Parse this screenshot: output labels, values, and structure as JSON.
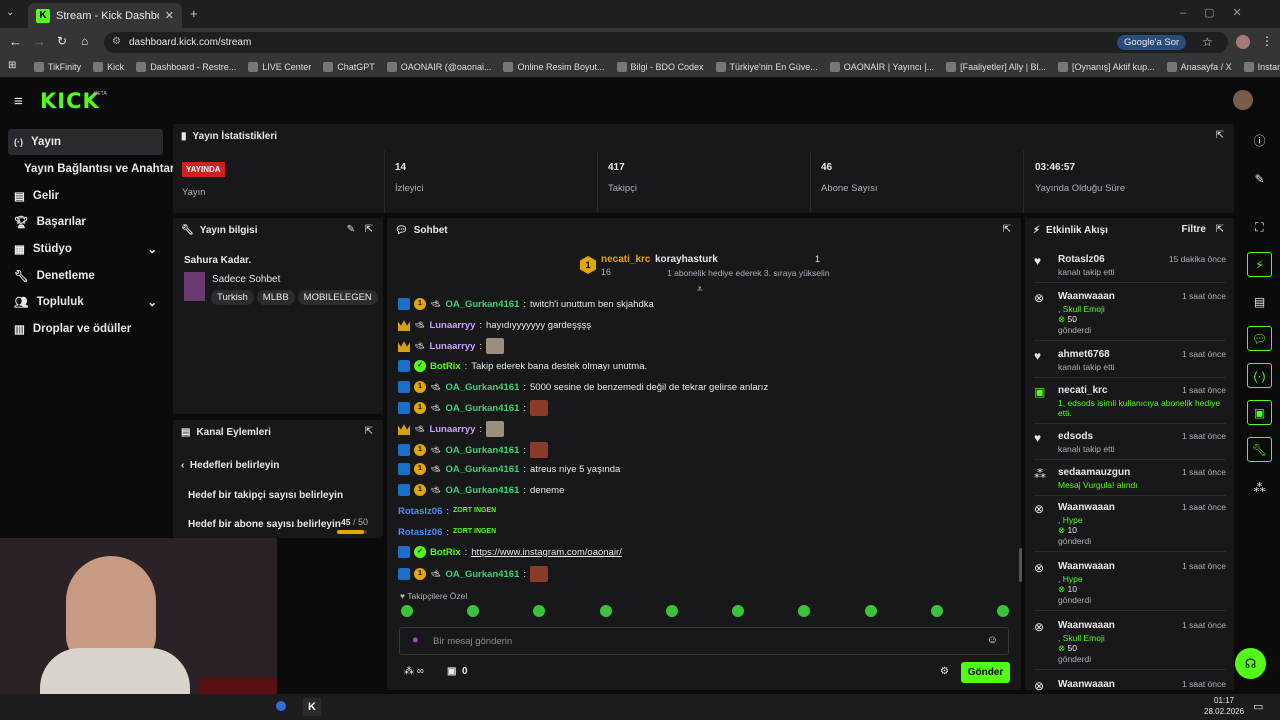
{
  "browser": {
    "tab_title": "Stream - Kick Dashboard",
    "url": "dashboard.kick.com/stream",
    "google_btn": "Google'a Sor",
    "bookmarks": [
      "TikFinity",
      "Kick",
      "Dashboard - Restre...",
      "LIVE Center",
      "ChatGPT",
      "OAONAIR (@oaonai...",
      "Online Resim Boyut...",
      "Bilgi - BDO Codex",
      "Türkiye'nin En Güve...",
      "OAONAIR | Yayıncı |...",
      "[Faaliyetler] Ally | Bl...",
      "[Oynanış] Aktif kup...",
      "Anasayfa / X",
      "Instant Background..."
    ]
  },
  "app": {
    "logo": "KICK",
    "beta": "BETA"
  },
  "nav": {
    "items": [
      "Yayın",
      "Yayın Bağlantısı ve Anahtarı",
      "Gelir",
      "Başarılar",
      "Stüdyo",
      "Denetleme",
      "Topluluk",
      "Droplar ve ödüller"
    ]
  },
  "stats": {
    "title": "Yayın İstatistikleri",
    "live_badge": "YAYINDA",
    "live_label": "Yayın",
    "items": [
      {
        "value": "14",
        "label": "İzleyici"
      },
      {
        "value": "417",
        "label": "Takipçi"
      },
      {
        "value": "46",
        "label": "Abone Sayısı"
      },
      {
        "value": "03:46:57",
        "label": "Yayında Olduğu Süre"
      }
    ]
  },
  "stream_info": {
    "title": "Yayın bilgisi",
    "stream_title": "Sahura Kadar.",
    "category": "Sadece Sohbet",
    "tags": [
      "Turkish",
      "MLBB",
      "MOBILELEGEN"
    ]
  },
  "channel_actions": {
    "title": "Kanal Eylemleri",
    "back": "Hedefleri belirleyin",
    "goal1": "Hedef bir takipçi sayısı belirleyin",
    "goal2": "Hedef bir abone sayısı belirleyin",
    "goal2_current": "45",
    "goal2_sep": " / ",
    "goal2_target": "50",
    "goal2_progress": 0.9
  },
  "chat": {
    "title": "Sohbet",
    "top_user": "necati_krc",
    "top_rank": "1",
    "top_count": "16",
    "gift_user": "korayhasturk",
    "gift_count": "1",
    "gift_text": "1 abonelik hediye ederek 3. sıraya yükselin",
    "messages": [
      {
        "user": "OA_Gurkan4161",
        "color": "#3bd16f",
        "text": "twitch'i unuttum ben skjahdka",
        "b": "abc",
        "emote": ""
      },
      {
        "user": "Lunaarryy",
        "color": "#c8a0ff",
        "text": "hayıdıyyyyyyy gardeşşşş",
        "b": "c",
        "emote": ""
      },
      {
        "user": "Lunaarryy",
        "color": "#c8a0ff",
        "text": "",
        "b": "c",
        "emote": "g"
      },
      {
        "user": "BotRix",
        "color": "#53fc18",
        "text": "Takip ederek bana destek olmayı unutma.",
        "b": "ab",
        "emote": ""
      },
      {
        "user": "OA_Gurkan4161",
        "color": "#3bd16f",
        "text": "5000 sesine de benzemedi değil de tekrar gelirse anlarız",
        "b": "abc",
        "emote": ""
      },
      {
        "user": "OA_Gurkan4161",
        "color": "#3bd16f",
        "text": "",
        "b": "abc",
        "emote": "r"
      },
      {
        "user": "Lunaarryy",
        "color": "#c8a0ff",
        "text": "",
        "b": "c",
        "emote": "g"
      },
      {
        "user": "OA_Gurkan4161",
        "color": "#3bd16f",
        "text": "",
        "b": "abc",
        "emote": "r"
      },
      {
        "user": "OA_Gurkan4161",
        "color": "#3bd16f",
        "text": "atreus niye 5 yaşında",
        "b": "abc",
        "emote": ""
      },
      {
        "user": "OA_Gurkan4161",
        "color": "#3bd16f",
        "text": "deneme",
        "b": "abc",
        "emote": ""
      },
      {
        "user": "Rotaslz06",
        "color": "#4a8cff",
        "text": "",
        "b": "",
        "emote": "z"
      },
      {
        "user": "Rotaslz06",
        "color": "#4a8cff",
        "text": "",
        "b": "",
        "emote": "z"
      },
      {
        "user": "BotRix",
        "color": "#53fc18",
        "text": "https://www.instagram.com/oaonair/",
        "b": "ab",
        "emote": ""
      },
      {
        "user": "OA_Gurkan4161",
        "color": "#3bd16f",
        "text": "",
        "b": "abc",
        "emote": "r"
      }
    ],
    "zort": "ZORT INGEN",
    "followers_only": "Takipçilere Özel",
    "placeholder": "Bir mesaj gönderin",
    "send": "Gönder",
    "points": "∞",
    "store_count": "0"
  },
  "activity": {
    "title": "Etkinlik Akışı",
    "filter": "Filtre",
    "events": [
      {
        "name": "Rotaslz06",
        "time": "15 dakika önce",
        "line1": "kanalı takip etti",
        "line2": "",
        "line3": "",
        "type": "follow"
      },
      {
        "name": "Waanwaaan",
        "time": "1 saat önce",
        "line1": ", Skull Emoji",
        "line2": "50",
        "line3": "gönderdi",
        "type": "kick"
      },
      {
        "name": "ahmet6768",
        "time": "1 saat önce",
        "line1": "kanalı takip etti",
        "line2": "",
        "line3": "",
        "type": "follow"
      },
      {
        "name": "necati_krc",
        "time": "1 saat önce",
        "line1": "1, edsods isimli kullanıcıya abonelik hediye etti.",
        "line2": "",
        "line3": "",
        "type": "gift"
      },
      {
        "name": "edsods",
        "time": "1 saat önce",
        "line1": "kanalı takip etti",
        "line2": "",
        "line3": "",
        "type": "follow"
      },
      {
        "name": "sedaamauzgun",
        "time": "1 saat önce",
        "line1": "Mesaj Vurgula! alındı",
        "line2": "",
        "line3": "",
        "type": "points"
      },
      {
        "name": "Waanwaaan",
        "time": "1 saat önce",
        "line1": ", Hype",
        "line2": "10",
        "line3": "gönderdi",
        "type": "kick"
      },
      {
        "name": "Waanwaaan",
        "time": "1 saat önce",
        "line1": ", Hype",
        "line2": "10",
        "line3": "gönderdi",
        "type": "kick"
      },
      {
        "name": "Waanwaaan",
        "time": "1 saat önce",
        "line1": ", Skull Emoji",
        "line2": "50",
        "line3": "gönderdi",
        "type": "kick"
      },
      {
        "name": "Waanwaaan",
        "time": "1 saat önce",
        "line1": "",
        "line2": "",
        "line3": "",
        "type": "kick"
      }
    ]
  },
  "taskbar": {
    "time": "01:17",
    "date": "28.02.2026"
  }
}
